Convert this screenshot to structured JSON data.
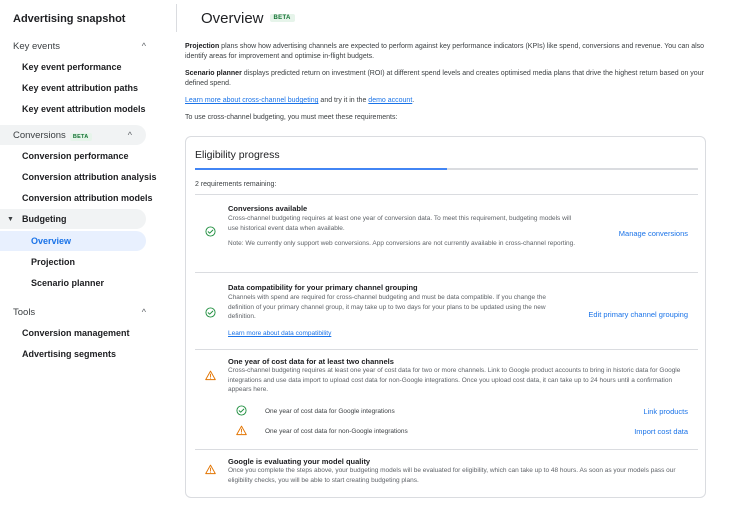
{
  "sidebar": {
    "title": "Advertising snapshot",
    "sections": [
      {
        "label": "Key events",
        "chevron": "^"
      },
      {
        "label": "Conversions",
        "badge": "BETA",
        "chevron": "^"
      },
      {
        "label": "Tools",
        "chevron": "^"
      }
    ],
    "items": [
      "Key event performance",
      "Key event attribution paths",
      "Key event attribution models",
      "Conversion performance",
      "Conversion attribution analysis",
      "Conversion attribution models",
      "Budgeting",
      "Overview",
      "Projection",
      "Scenario planner",
      "Conversion management",
      "Advertising segments"
    ]
  },
  "header": {
    "title": "Overview",
    "badge": "BETA"
  },
  "intro": {
    "projection_bold": "Projection",
    "projection_text": " plans show how advertising channels are expected to perform against key performance indicators (KPIs) like spend, conversions and revenue. You can also identify areas for improvement and optimise in-flight budgets.",
    "scenario_bold": "Scenario planner",
    "scenario_text": " displays predicted return on investment (ROI) at different spend levels and creates optimised media plans that drive the highest return based on your defined spend.",
    "learn_link": "Learn more about cross-channel budgeting",
    "learn_mid": " and try it in the ",
    "demo_link": "demo account",
    "learn_end": ".",
    "requirements": "To use cross-channel budgeting, you must meet these requirements:"
  },
  "eligibility": {
    "title": "Eligibility progress",
    "progress": 0.5,
    "remaining": "2 requirements remaining:",
    "requirements": [
      {
        "title": "Conversions available",
        "desc": "Cross-channel budgeting requires at least one year of conversion data. To meet this requirement, budgeting models will use historical event data when available.",
        "note": "Note: We currently only support web conversions. App conversions are not currently available in cross-channel reporting.",
        "action": "Manage conversions",
        "status": "check-circle-icon"
      },
      {
        "title": "Data compatibility for your primary channel grouping",
        "desc": "Channels with spend are required for cross-channel budgeting and must be data compatible. If you change the definition of your primary channel group, it may take up to two days for your plans to be updated using the new definition.",
        "link": "Learn more about data compatibility",
        "action": "Edit primary channel grouping",
        "status": "check-circle-icon"
      },
      {
        "title": "One year of cost data for at least two channels",
        "desc": "Cross-channel budgeting requires at least one year of cost data for two or more channels. Link to Google product accounts to bring in historic data for Google integrations and use data import to upload cost data for non-Google integrations. Once you upload cost data, it can take up to 24 hours until a confirmation appears here.",
        "status": "warning-icon",
        "subrows": [
          {
            "text": "One year of cost data for Google integrations",
            "action": "Link products",
            "status": "check-circle-icon"
          },
          {
            "text": "One year of cost data for non-Google integrations",
            "action": "Import cost data",
            "status": "warning-icon"
          }
        ]
      },
      {
        "title": "Google is evaluating your model quality",
        "desc": "Once you complete the steps above, your budgeting models will be evaluated for eligibility, which can take up to 48 hours. As soon as your models pass our eligibility checks, you will be able to start creating budgeting plans.",
        "status": "warning-icon"
      }
    ]
  },
  "colors": {
    "accent": "#1a73e8",
    "success": "#1e8e3e",
    "warning": "#e37400",
    "beta_bg": "#e6f4ea",
    "beta_fg": "#137333"
  }
}
